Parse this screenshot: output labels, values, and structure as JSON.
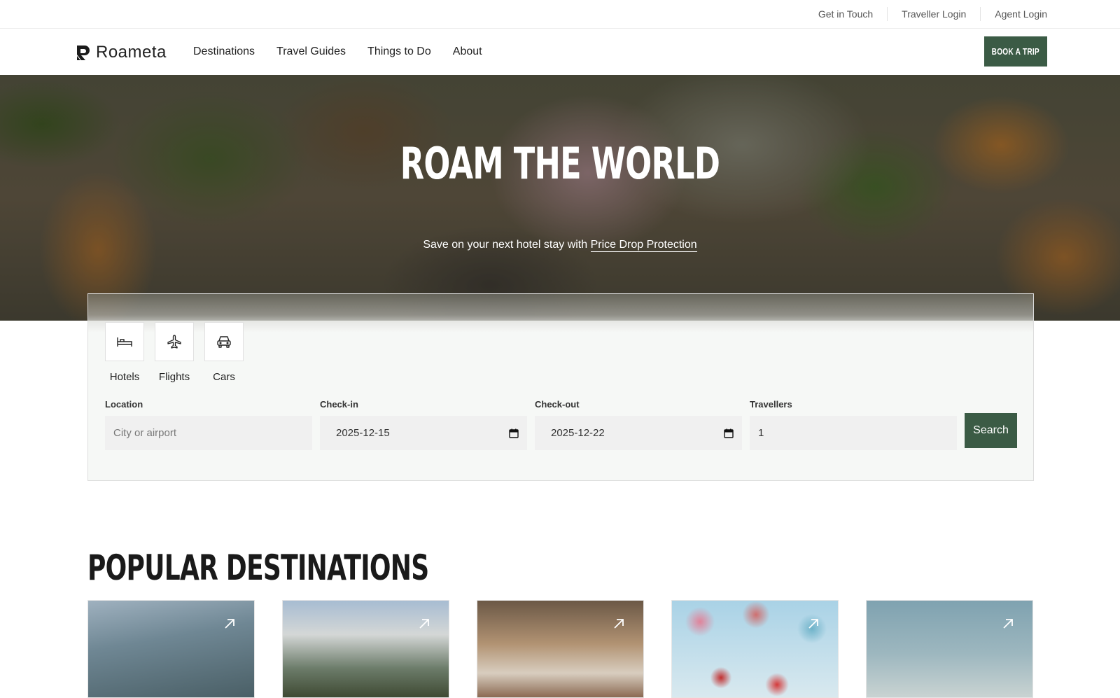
{
  "topbar": {
    "links": [
      "Get in Touch",
      "Traveller Login",
      "Agent Login"
    ]
  },
  "nav": {
    "logo_text": "Roameta",
    "links": [
      "Destinations",
      "Travel Guides",
      "Things to Do",
      "About"
    ],
    "book_label": "BOOK A TRIP"
  },
  "hero": {
    "title": "ROAM THE WORLD",
    "subtitle_prefix": "Save on your next hotel stay with ",
    "subtitle_link": "Price Drop Protection"
  },
  "search": {
    "modes": [
      {
        "label": "Hotels",
        "icon": "bed-icon"
      },
      {
        "label": "Flights",
        "icon": "plane-icon"
      },
      {
        "label": "Cars",
        "icon": "car-icon"
      }
    ],
    "location": {
      "label": "Location",
      "placeholder": "City or airport",
      "value": ""
    },
    "checkin": {
      "label": "Check-in",
      "value": "2025-12-15"
    },
    "checkout": {
      "label": "Check-out",
      "value": "2025-12-22"
    },
    "travellers": {
      "label": "Travellers",
      "value": "1"
    },
    "button_label": "Search"
  },
  "popular": {
    "title": "POPULAR DESTINATIONS",
    "card_count_icon": "arrow-up-right-icon"
  },
  "colors": {
    "brand_green": "#3b5b45"
  }
}
